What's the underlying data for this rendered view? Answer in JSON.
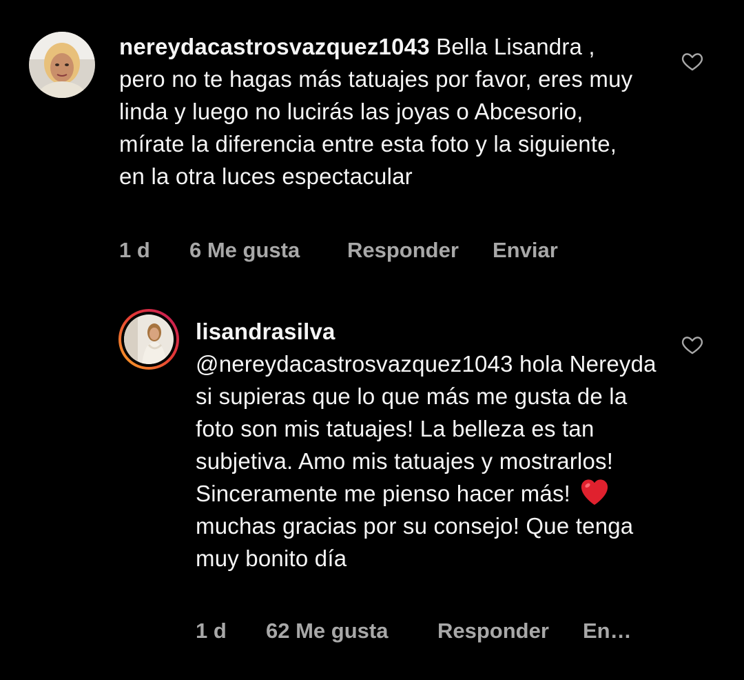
{
  "comments": [
    {
      "username": "nereydacastrosvazquez1043",
      "text_after_username": " Bella Lisandra , pero no te hagas más tatuajes por favor, eres muy linda y luego no lucirás las joyas o Abcesorio, mírate la diferencia entre esta foto y la siguiente, en la otra luces espectacular",
      "time": "1 d",
      "likes": "6 Me gusta",
      "reply_label": "Responder",
      "send_label": "Enviar",
      "like_icon": "heart-outline-icon"
    },
    {
      "username": "lisandrasilva",
      "mention": "@nereydacastrosvazquez1043",
      "text_part1": " hola Nereyda si supieras que lo que más me gusta de la foto son mis tatuajes! La belleza es tan subjetiva. Amo mis tatuajes y mostrarlos! Sinceramente me pienso hacer más!",
      "emoji": "red-heart-emoji",
      "text_part2": " muchas gracias por su consejo! Que tenga muy bonito día",
      "time": "1 d",
      "likes": "62 Me gusta",
      "reply_label": "Responder",
      "send_label": "En…",
      "like_icon": "heart-outline-icon"
    }
  ],
  "colors": {
    "background": "#000000",
    "text": "#f5f5f5",
    "meta": "#a8a8a8",
    "story_ring_start": "#f9a825",
    "story_ring_end": "#c2185b",
    "emoji_heart": "#e0212e"
  }
}
